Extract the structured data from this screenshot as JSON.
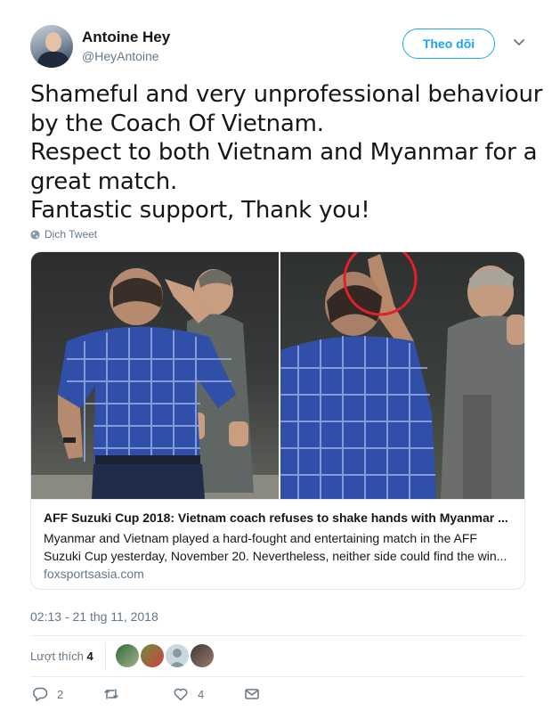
{
  "author": {
    "name": "Antoine Hey",
    "handle": "@HeyAntoine",
    "follow_label": "Theo dõi"
  },
  "tweet": {
    "lines": [
      "Shameful and very unprofessional  behaviour",
      "by the Coach Of Vietnam.",
      "Respect to both Vietnam and Myanmar for a",
      "great match.",
      "Fantastic support, Thank you!"
    ],
    "translate_label": "Dịch Tweet"
  },
  "card": {
    "title": "AFF Suzuki Cup 2018: Vietnam coach refuses to shake hands with Myanmar ...",
    "description_lines": [
      "Myanmar and Vietnam played a hard-fought and entertaining match in the AFF",
      "Suzuki Cup yesterday, November 20. Nevertheless, neither side could find the win..."
    ],
    "domain": "foxsportsasia.com"
  },
  "timestamp": "02:13 - 21 thg 11, 2018",
  "likes": {
    "label": "Lượt thích",
    "count": "4"
  },
  "actions": {
    "reply_count": "2",
    "retweet_count": "",
    "like_count": "4"
  },
  "colors": {
    "accent": "#1da1f2",
    "text": "#14171a",
    "muted": "#657786",
    "highlight_circle": "#e0202a"
  },
  "icons": [
    "caret-down-icon",
    "globe-icon",
    "reply-icon",
    "retweet-icon",
    "heart-icon",
    "message-icon"
  ]
}
